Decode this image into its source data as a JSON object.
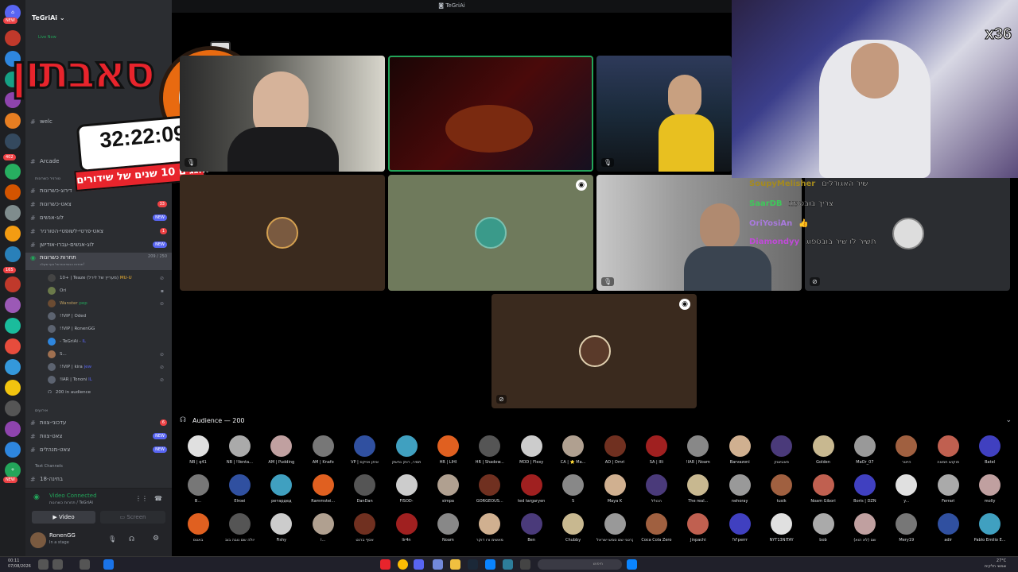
{
  "window_title": "TeGriAi",
  "server": {
    "name": "TeGriAi",
    "live_label": "Live Now"
  },
  "rail": {
    "badges": [
      "NEW",
      "402",
      "165",
      "NEW"
    ]
  },
  "channels": [
    {
      "label": "welc",
      "count": ""
    },
    {
      "label": "Arcade",
      "count": ""
    },
    {
      "label": "דירוג-כשרונות",
      "count": ""
    },
    {
      "label": "צאט-כשרונות",
      "count": "33"
    },
    {
      "label": "לוג-אנשים",
      "count": "NEW"
    },
    {
      "label": "צאט-פרטי-לשופטי-הטורניר",
      "count": "1"
    },
    {
      "label": "לוג-אנשים-עברו-אודישן",
      "count": "NEW"
    }
  ],
  "category_talent": "טורניר כשרונות",
  "active_channel": {
    "label": "תחרות כשרונות",
    "count": "209 / 250",
    "sub": "תחרות הכשרונות של אוף שקלה!"
  },
  "voice_users": [
    {
      "name": "10+ | Teaze (מעריץ של לירל)",
      "tag": "MU-U"
    },
    {
      "name": "Ori",
      "tag": ""
    },
    {
      "name": "Wanster",
      "tag": "pep"
    },
    {
      "name": "!!VIP | Oded",
      "tag": ""
    },
    {
      "name": "!!VIP | RonenGG",
      "tag": ""
    },
    {
      "name": "- TeGriAi -",
      "tag": "IL"
    },
    {
      "name": "S...",
      "tag": ""
    },
    {
      "name": "!!VIP | kira",
      "tag": "jew"
    },
    {
      "name": "!IAR | Tononi",
      "tag": "IL"
    }
  ],
  "audience_link": "200 in audience",
  "category_other": "אירועים",
  "channels_lower": [
    {
      "label": "עדכוני-צוות",
      "count": "6"
    },
    {
      "label": "צאט-צוות",
      "count": "NEW"
    },
    {
      "label": "צאט-מנהלים",
      "count": "NEW"
    }
  ],
  "text_channels_header": "Text Channels",
  "channel_bottom": {
    "label": "בחינה-18",
    "count": "NEW"
  },
  "voice_panel": {
    "title": "Video Connected",
    "subtitle": "תחרות כשרונות / TeGriAi",
    "video_btn": "Video",
    "screen_btn": "Screen"
  },
  "user_panel": {
    "name": "RonenGG",
    "status": "In a stage"
  },
  "overlay": {
    "word": "סאבתון",
    "timer": "32:22:09",
    "band": "חוגגים 10 שנים של שידורים"
  },
  "webcam": {
    "badge": "x36"
  },
  "chat": [
    {
      "user": "SoupyMelisher",
      "msg": "שיר האגודלים",
      "color": "#a58a1e"
    },
    {
      "user": "SaarDB",
      "msg": "צריך בובספוג",
      "color": "#3ec95a"
    },
    {
      "user": "OriYosiAn",
      "msg": "👍",
      "color": "#a87adc"
    },
    {
      "user": "Diamondyy",
      "msg": "תשיר לו שיר בובספוג",
      "color": "#c04ad8"
    }
  ],
  "tiles_colors": {
    "accent": "#23a55a",
    "tile_bg": "#3a2a1e",
    "green_tile": "#6f7a5c"
  },
  "audience": {
    "label": "Audience — 200",
    "members": [
      "NB | q41",
      "NB | !Venta...",
      "AM | Pudding",
      "AM | Knafo",
      "VP | איתן אזיקס",
      "תמיר, רווק נחשק",
      "HR | LIHI",
      "HR | Shadow...",
      "MOD | Flexy",
      "CA | ⭐ Ma...",
      "AD | Omri",
      "SA | Illi",
      "!IAR | Noam",
      "Barvazoni",
      "פאטיצוק",
      "Golden",
      "MaOr_07",
      "הייטר",
      "פוקוש חמאה",
      "Batel",
      "B...",
      "Elroei",
      "ретардед",
      "Rammstei...",
      "DanDan",
      "FISOD-",
      "simpa",
      "GORGEOUS...",
      "ted targaryen",
      "S",
      "Maya K",
      "הכולל",
      "The real...",
      "nehoray",
      "tusik",
      "Noam Gibori",
      "Boris | DZN",
      "y...",
      "Ferrari",
      "molly",
      "באטס",
      "יולה שם נובה בוב",
      "Fishy",
      "i...",
      "אסף ברנט",
      "lir4n",
      "Noam",
      "מאשימ ורו דוקר",
      "Ben",
      "Chubby",
      "קרטני שם סמש ישראל",
      "Coca Cola Zero",
      "Jinpachi",
      "!V!perrr",
      "NYT13NITAY",
      "bob",
      "שם (לא הוא)",
      "Mery19",
      "adir",
      "Pablo Emilio E..."
    ]
  },
  "taskbar": {
    "time": "00:11",
    "date": "07/08/2026",
    "search_placeholder": "חיפוש",
    "weather": "27°C",
    "weather_sub": "שמשי חלקית"
  }
}
